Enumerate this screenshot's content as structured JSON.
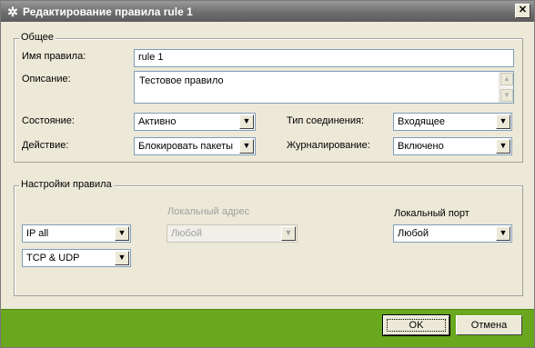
{
  "window": {
    "title": "Редактирование правила rule 1",
    "app_icon": "app-icon",
    "close_symbol": "✕"
  },
  "general": {
    "legend": "Общее",
    "name_label": "Имя правила:",
    "name_value": "rule 1",
    "description_label": "Описание:",
    "description_value": "Тестовое правило",
    "state_label": "Состояние:",
    "state_value": "Активно",
    "action_label": "Действие:",
    "action_value": "Блокировать пакеты",
    "connection_type_label": "Тип соединения:",
    "connection_type_value": "Входящее",
    "logging_label": "Журналирование:",
    "logging_value": "Включено"
  },
  "rule_settings": {
    "legend": "Настройки правила",
    "protocol_value": "IP all",
    "transport_value": "TCP & UDP",
    "local_address_label": "Локальный адрес",
    "local_address_value": "Любой",
    "local_port_label": "Локальный порт",
    "local_port_value": "Любой"
  },
  "footer": {
    "ok_label": "OK",
    "cancel_label": "Отмена"
  }
}
